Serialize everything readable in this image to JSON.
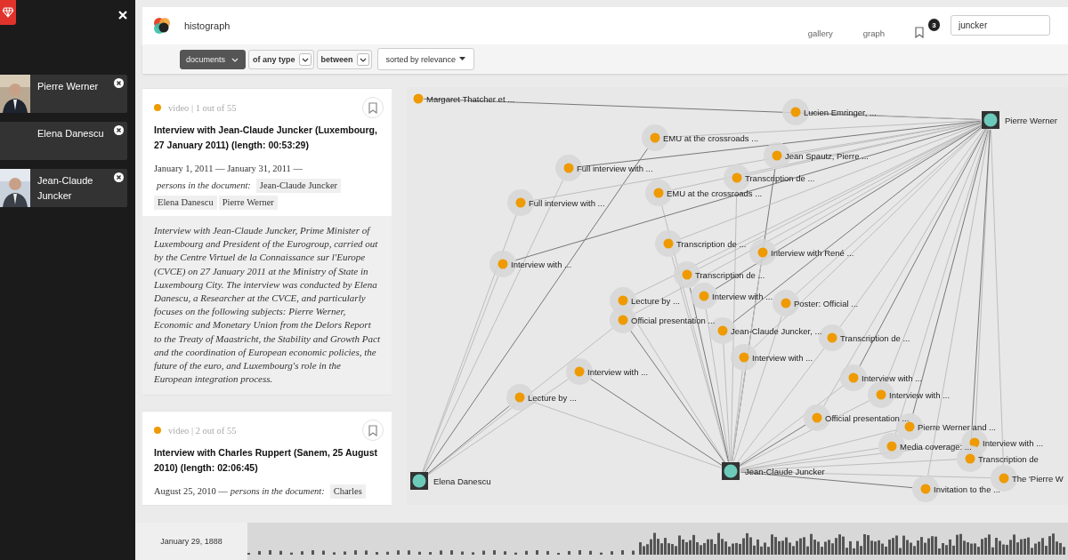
{
  "sidebar": {
    "pinned": [
      {
        "name": "Pierre Werner",
        "has_photo": true
      },
      {
        "name": "Elena Danescu",
        "has_photo": false
      },
      {
        "name": "Jean-Claude Juncker",
        "has_photo": true
      }
    ]
  },
  "header": {
    "app_name": "histograph",
    "nav": [
      "gallery",
      "graph"
    ],
    "bookmark_count": "3",
    "search": {
      "value": "juncker"
    }
  },
  "filters": [
    {
      "label": "documents",
      "selected": true
    },
    {
      "label": "of any type",
      "selected": false
    },
    {
      "label": "between",
      "selected": false
    }
  ],
  "sort": {
    "label": "sorted by relevance"
  },
  "documents": [
    {
      "meta": "video | 1 out of 55",
      "color": "#ee9a00",
      "title": "Interview with Jean-Claude Juncker (Luxembourg, 27 January 2011) (length: 00:53:29)",
      "dates": "January 1, 2011 — January 31, 2011 —",
      "persons_label": "persons in the document:",
      "persons": [
        "Jean-Claude Juncker",
        "Elena Danescu",
        "Pierre Werner"
      ],
      "description": "Interview with Jean-Claude Juncker, Prime Minister of Luxembourg and President of the Eurogroup, carried out by the Centre Virtuel de la Connaissance sur l'Europe (CVCE) on 27 January 2011 at the Ministry of State in Luxembourg City. The interview was conducted by Elena Danescu, a Researcher at the CVCE, and particularly focuses on the following subjects: Pierre Werner, Economic and Monetary Union from the Delors Report to the Treaty of Maastricht, the Stability and Growth Pact and the coordination of European economic policies, the future of the euro, and Luxembourg's role in the European integration process."
    },
    {
      "meta": "video | 2 out of 55",
      "color": "#ee9a00",
      "title": "Interview with Charles Ruppert (Sanem, 25 August 2010) (length: 02:06:45)",
      "dates": "August 25, 2010 —",
      "persons_label": "persons in the document:",
      "persons": [
        "Charles"
      ]
    }
  ],
  "graph": {
    "persons": [
      {
        "label": "Pierre Werner"
      },
      {
        "label": "Jean-Claude Juncker"
      },
      {
        "label": "Elena Danescu"
      }
    ],
    "documents": [
      {
        "label": "Margaret Thatcher et ..."
      },
      {
        "label": "Lucien Emringer, ..."
      },
      {
        "label": "EMU at the crossroads ..."
      },
      {
        "label": "Jean Spautz, Pierre ..."
      },
      {
        "label": "Full interview with ..."
      },
      {
        "label": "Transcription de ..."
      },
      {
        "label": "EMU at the crossroads ..."
      },
      {
        "label": "Full interview with ..."
      },
      {
        "label": "Interview with ..."
      },
      {
        "label": "Transcription de ..."
      },
      {
        "label": "Interview with René ..."
      },
      {
        "label": "Transcription de ..."
      },
      {
        "label": "Interview with ..."
      },
      {
        "label": "Poster: Official ..."
      },
      {
        "label": "Lecture by ..."
      },
      {
        "label": "Official presentation ..."
      },
      {
        "label": "Jean-Claude Juncker, ..."
      },
      {
        "label": "Transcription de ..."
      },
      {
        "label": "Interview with ..."
      },
      {
        "label": "Interview with ..."
      },
      {
        "label": "Interview with ..."
      },
      {
        "label": "Interview with ..."
      },
      {
        "label": "Lecture by ..."
      },
      {
        "label": "Official presentation ..."
      },
      {
        "label": "Pierre Werner and ..."
      },
      {
        "label": "Media coverage: ..."
      },
      {
        "label": "Interview with ..."
      },
      {
        "label": "Invitation to the ..."
      },
      {
        "label": "Transcription de"
      },
      {
        "label": "The 'Pierre W"
      }
    ]
  },
  "timeline": {
    "date": "January 29, 1888"
  }
}
